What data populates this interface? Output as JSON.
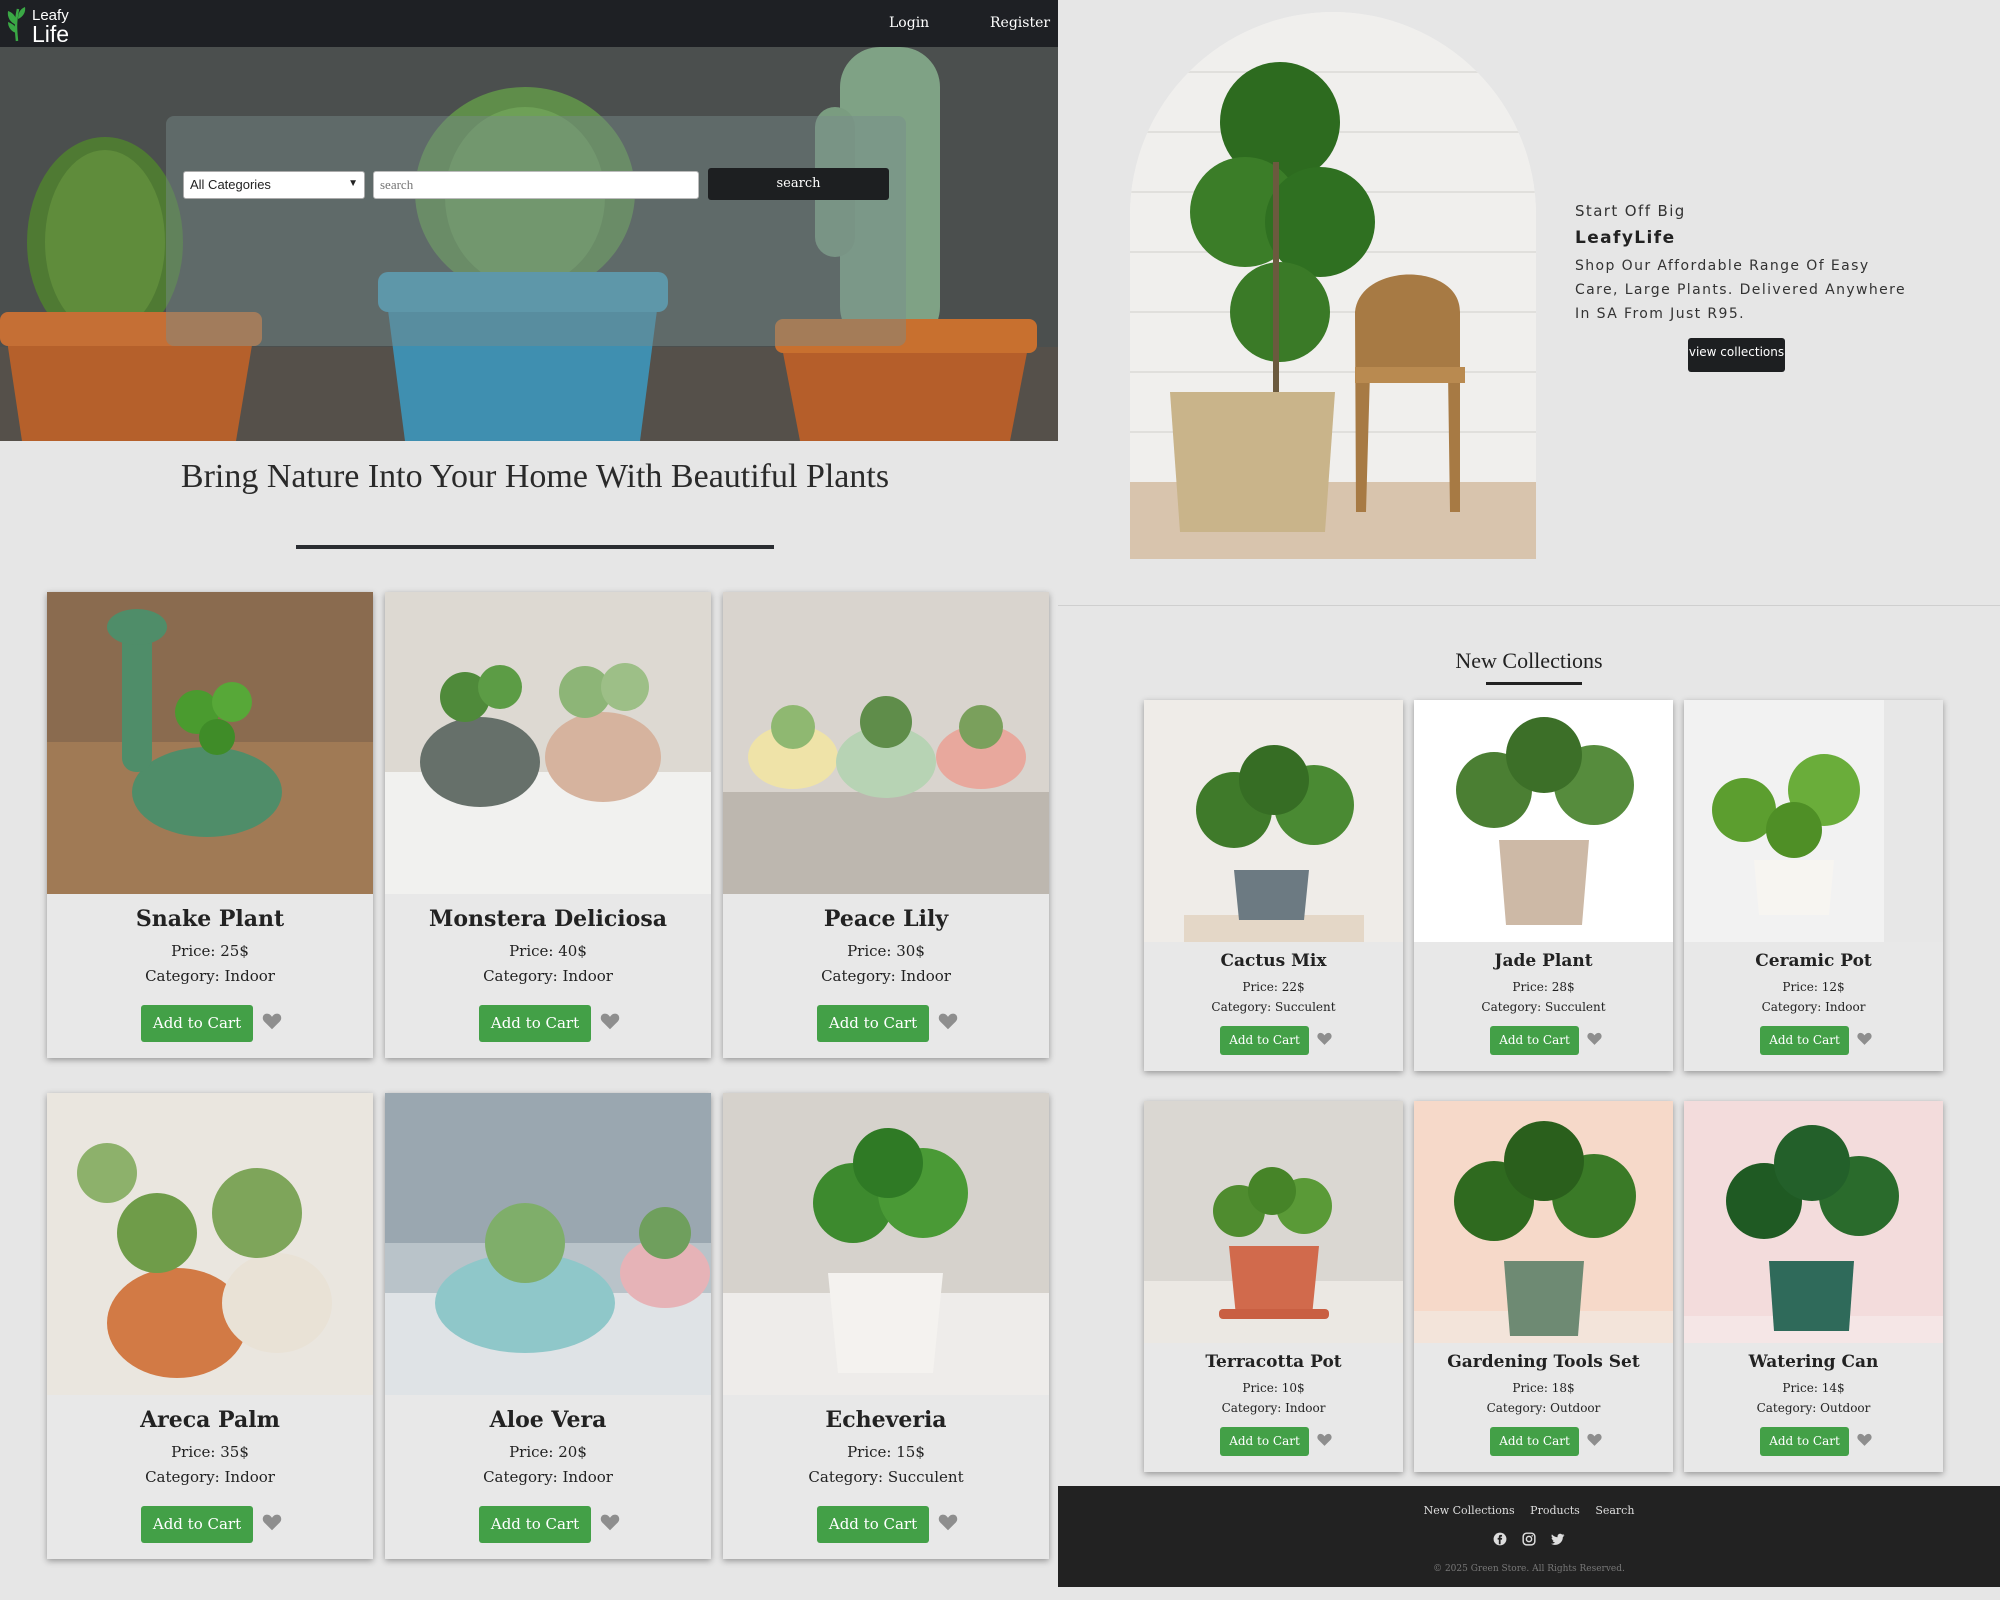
{
  "brand": {
    "line1": "Leafy",
    "line2": "Life"
  },
  "nav": {
    "login": "Login",
    "register": "Register"
  },
  "hero": {
    "category_value": "All Categories",
    "search_placeholder": "search",
    "search_button": "search"
  },
  "tagline": "Bring Nature Into Your Home With Beautiful Plants",
  "products": [
    {
      "name": "Snake Plant",
      "price": "Price: 25$",
      "category": "Category: Indoor",
      "cart": "Add to Cart"
    },
    {
      "name": "Monstera Deliciosa",
      "price": "Price: 40$",
      "category": "Category: Indoor",
      "cart": "Add to Cart"
    },
    {
      "name": "Peace Lily",
      "price": "Price: 30$",
      "category": "Category: Indoor",
      "cart": "Add to Cart"
    },
    {
      "name": "Areca Palm",
      "price": "Price: 35$",
      "category": "Category: Indoor",
      "cart": "Add to Cart"
    },
    {
      "name": "Aloe Vera",
      "price": "Price: 20$",
      "category": "Category: Indoor",
      "cart": "Add to Cart"
    },
    {
      "name": "Echeveria",
      "price": "Price: 15$",
      "category": "Category: Succulent",
      "cart": "Add to Cart"
    }
  ],
  "promo": {
    "line1": "Start Off Big",
    "line2": "LeafyLife",
    "line3": "Shop Our Affordable Range Of Easy Care, Large Plants. Delivered Anywhere In SA From Just R95.",
    "button": "view collections"
  },
  "new_collections": {
    "title": "New Collections",
    "items": [
      {
        "name": "Cactus Mix",
        "price": "Price: 22$",
        "category": "Category: Succulent",
        "cart": "Add to Cart"
      },
      {
        "name": "Jade Plant",
        "price": "Price: 28$",
        "category": "Category: Succulent",
        "cart": "Add to Cart"
      },
      {
        "name": "Ceramic Pot",
        "price": "Price: 12$",
        "category": "Category: Indoor",
        "cart": "Add to Cart"
      },
      {
        "name": "Terracotta Pot",
        "price": "Price: 10$",
        "category": "Category: Indoor",
        "cart": "Add to Cart"
      },
      {
        "name": "Gardening Tools Set",
        "price": "Price: 18$",
        "category": "Category: Outdoor",
        "cart": "Add to Cart"
      },
      {
        "name": "Watering Can",
        "price": "Price: 14$",
        "category": "Category: Outdoor",
        "cart": "Add to Cart"
      }
    ]
  },
  "footer": {
    "links": [
      "New Collections",
      "Products",
      "Search"
    ],
    "social_icons": [
      "facebook-icon",
      "instagram-icon",
      "twitter-icon"
    ],
    "copyright": "© 2025 Green Store. All Rights Reserved."
  },
  "colors": {
    "accent": "#43a047",
    "dark": "#1e2024",
    "background": "#e6e6e6"
  }
}
